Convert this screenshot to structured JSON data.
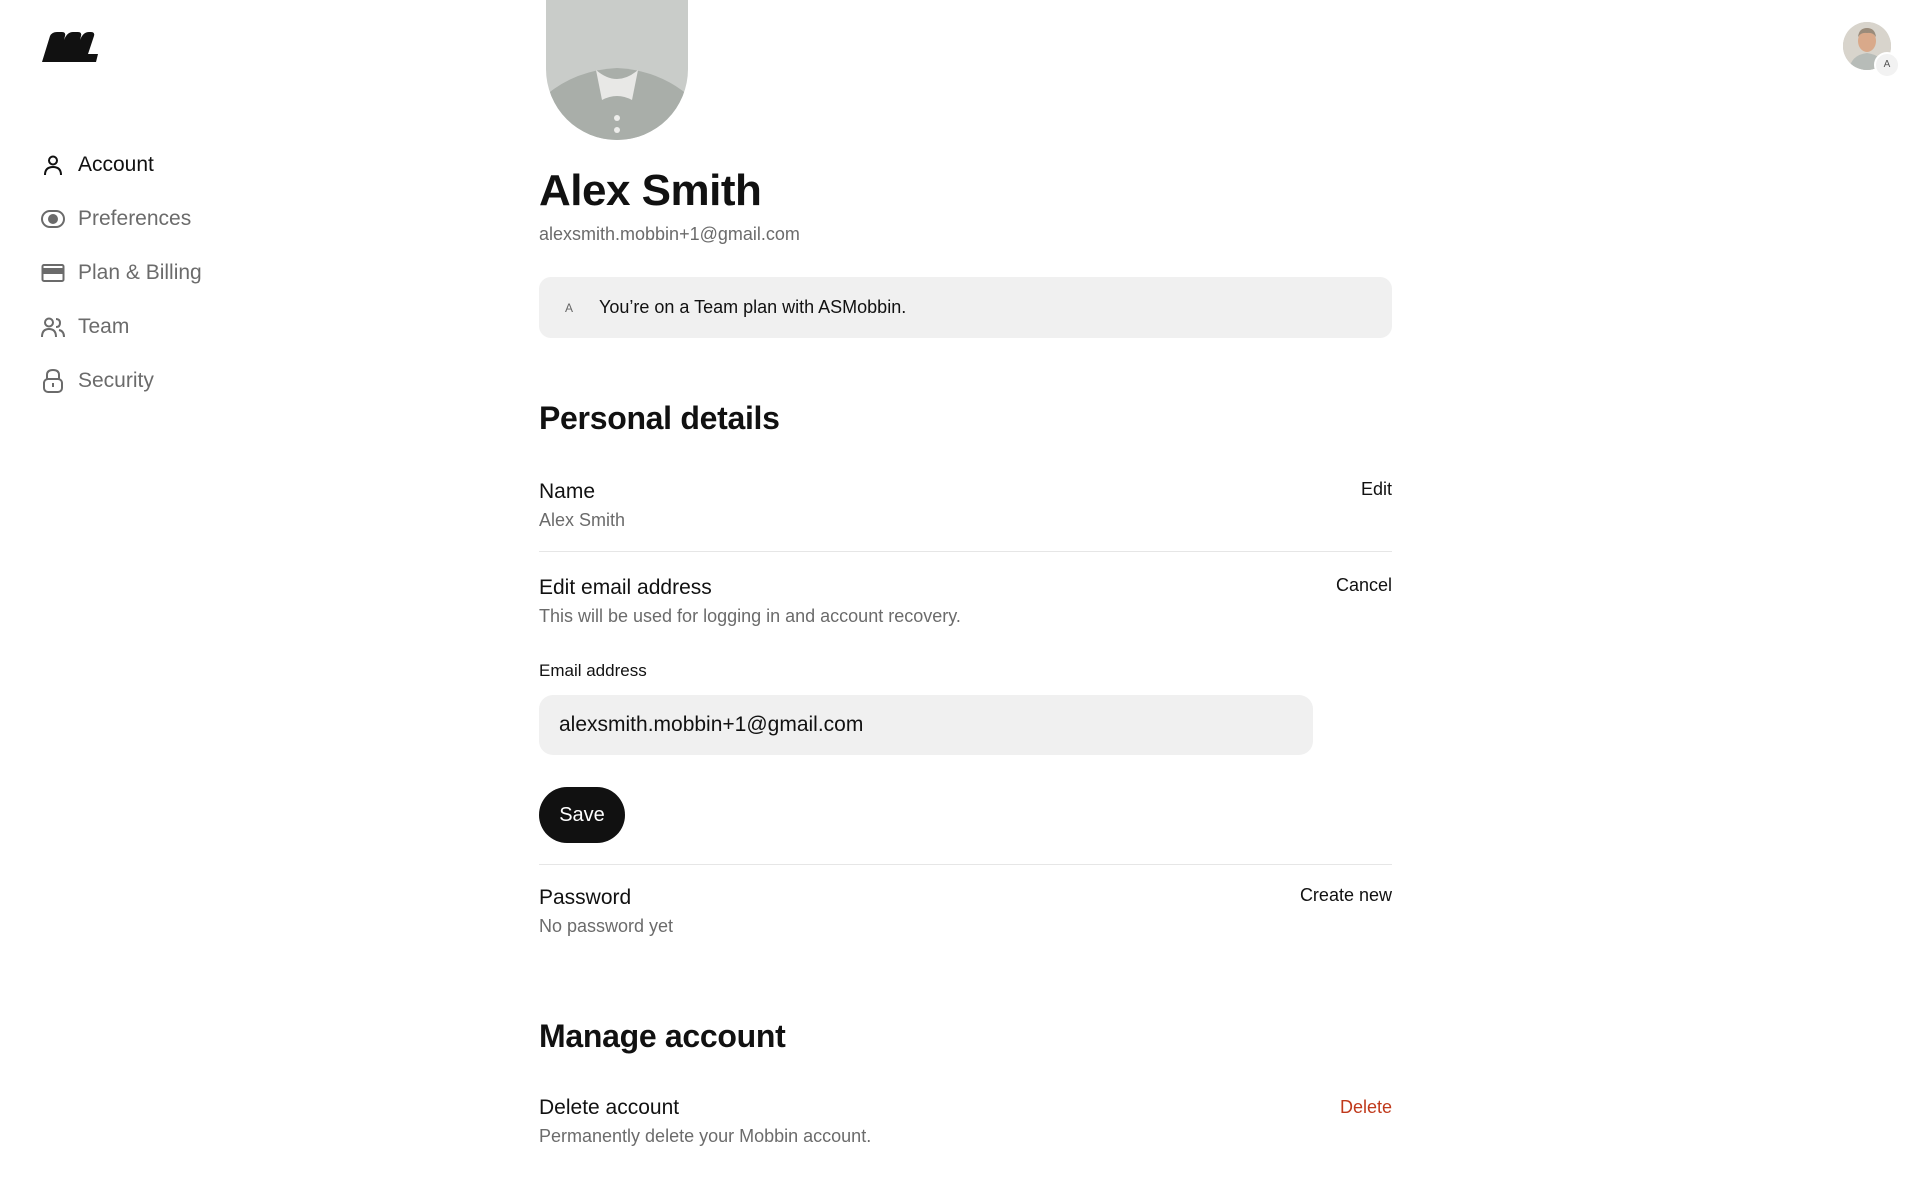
{
  "header": {
    "logo": "mobbin-logo",
    "avatar_badge": "A"
  },
  "sidebar": {
    "items": [
      {
        "label": "Account",
        "icon": "person-icon",
        "active": true
      },
      {
        "label": "Preferences",
        "icon": "eye-toggle-icon",
        "active": false
      },
      {
        "label": "Plan & Billing",
        "icon": "credit-card-icon",
        "active": false
      },
      {
        "label": "Team",
        "icon": "team-icon",
        "active": false
      },
      {
        "label": "Security",
        "icon": "lock-icon",
        "active": false
      }
    ]
  },
  "profile": {
    "name": "Alex Smith",
    "email": "alexsmith.mobbin+1@gmail.com"
  },
  "plan_banner": {
    "badge": "A",
    "text": "You’re on a Team plan with ASMobbin."
  },
  "personal_details": {
    "title": "Personal details",
    "name_row": {
      "label": "Name",
      "value": "Alex Smith",
      "action": "Edit"
    },
    "email_row": {
      "label": "Edit email address",
      "description": "This will be used for logging in and account recovery.",
      "action": "Cancel",
      "field_label": "Email address",
      "field_value": "alexsmith.mobbin+1@gmail.com",
      "save_label": "Save"
    },
    "password_row": {
      "label": "Password",
      "value": "No password yet",
      "action": "Create new"
    }
  },
  "manage_account": {
    "title": "Manage account",
    "delete_row": {
      "label": "Delete account",
      "description": "Permanently delete your Mobbin account.",
      "action": "Delete"
    }
  },
  "colors": {
    "primary": "#111111",
    "muted_text": "#6b6b6b",
    "surface": "#f0f0f0",
    "danger": "#c0391b"
  }
}
